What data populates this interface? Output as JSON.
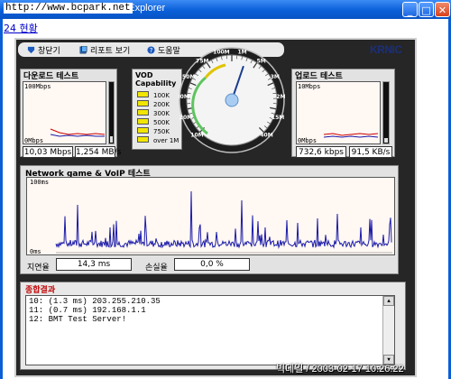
{
  "window": {
    "url_overlay": "http://www.bcpark.net",
    "title": "at Explorer",
    "buttons": {
      "minimize": "_",
      "maximize": "□",
      "close": "✕"
    }
  },
  "page": {
    "top_link": "24 현황"
  },
  "toolbar": {
    "close_label": "창닫기",
    "report_label": "리포트 보기",
    "help_label": "도움말",
    "logo": "KRNIC"
  },
  "download": {
    "title": "다운로드 테스트",
    "ymax": "100Mbps",
    "ymin": "0Mbps",
    "speed_bps": "10,03 Mbps",
    "speed_bytes": "1,254 MB/s",
    "level_fraction": 0.1
  },
  "upload": {
    "title": "업로드 테스트",
    "ymax": "10Mbps",
    "ymin": "0Mbps",
    "speed_bps": "732,6 kbps",
    "speed_bytes": "91,5 KB/s",
    "level_fraction": 0.07
  },
  "vod": {
    "title_line1": "VOD",
    "title_line2": "Capability",
    "levels": [
      "100K",
      "200K",
      "300K",
      "500K",
      "750K",
      "over 1M"
    ],
    "swatch_color": "#f2e600"
  },
  "gauge": {
    "scale_labels": [
      "10M",
      "20M",
      "30M",
      "50M",
      "75M",
      "100M",
      "1M",
      "5M",
      "3M",
      "2M",
      "15M",
      "40M"
    ],
    "needle_fraction": 0.57
  },
  "network": {
    "title": "Network game & VoIP 테스트",
    "ymax": "100ms",
    "ymin": "0ms",
    "latency_label": "지연율",
    "latency_value": "14,3 ms",
    "loss_label": "손실율",
    "loss_value": "0,0 %"
  },
  "result": {
    "title": "종합결과",
    "lines": [
      "10: (1.3 ms) 203.255.210.35",
      "11: (0.7 ms) 192.168.1.1",
      "12: BMT Test Server!"
    ]
  },
  "footer": {
    "watermark": "빅데일 / 2003-02-17 10:26:22"
  },
  "colors": {
    "panel_bg": "#262626",
    "accent_title": "#0a5fd8",
    "result_title": "#c00000",
    "line_blue": "#1a1aa8",
    "line_red": "#cc0000"
  }
}
